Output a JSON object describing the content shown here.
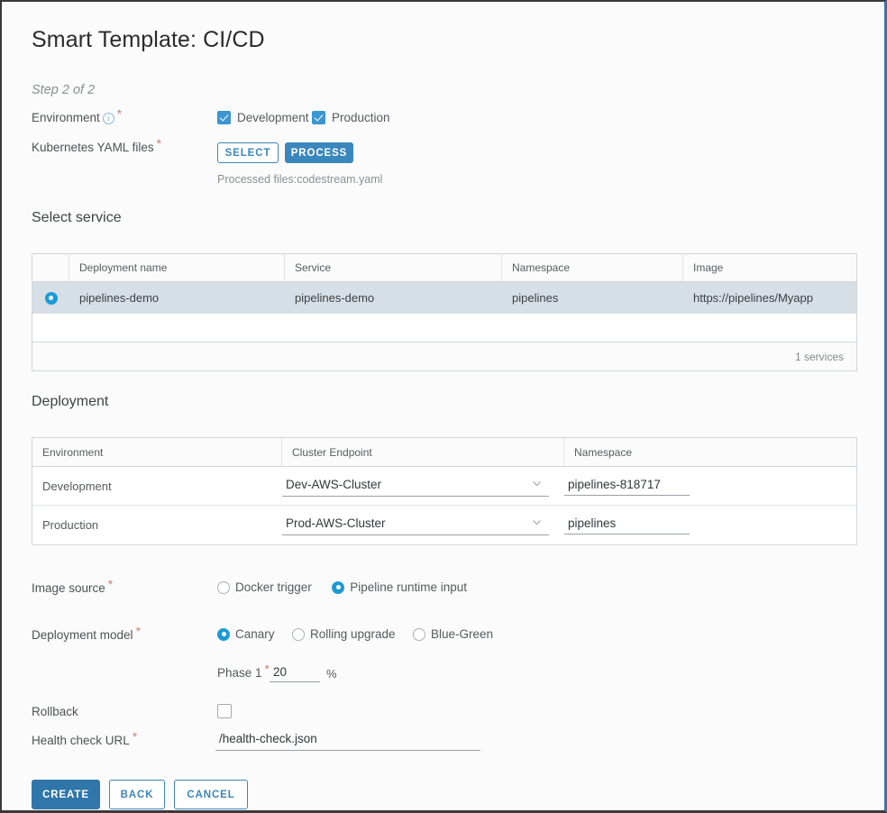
{
  "window": {
    "title": "Smart Template: CI/CD",
    "step_label": "Step 2 of 2",
    "accent_color": "#3076a8",
    "link_color": "#3b86b8",
    "required_mark_color": "#c8847a",
    "selected_row_color": "#d6dfe5"
  },
  "form": {
    "environment": {
      "label": "Environment",
      "info_icon": "info-circle-icon",
      "required_mark": "*",
      "options": [
        {
          "label": "Development",
          "checked": true
        },
        {
          "label": "Production",
          "checked": true
        }
      ]
    },
    "yaml_files": {
      "label": "Kubernetes YAML files",
      "required_mark": "*",
      "select_button": "SELECT",
      "process_button": "PROCESS",
      "processed_note": "Processed files:codestream.yaml"
    },
    "image_source": {
      "label": "Image source",
      "required_mark": "*",
      "options": [
        {
          "label": "Docker trigger",
          "selected": false
        },
        {
          "label": "Pipeline runtime input",
          "selected": true
        }
      ]
    },
    "deployment_model": {
      "label": "Deployment model",
      "required_mark": "*",
      "options": [
        {
          "label": "Canary",
          "selected": true
        },
        {
          "label": "Rolling upgrade",
          "selected": false
        },
        {
          "label": "Blue-Green",
          "selected": false
        }
      ],
      "phase": {
        "label": "Phase 1",
        "required_mark": "*",
        "value": "20",
        "unit": "%"
      }
    },
    "rollback": {
      "label": "Rollback",
      "checked": false
    },
    "health_check": {
      "label": "Health check URL",
      "required_mark": "*",
      "value": "/health-check.json",
      "placeholder": ""
    }
  },
  "select_service": {
    "heading": "Select service",
    "columns": [
      "Deployment name",
      "Service",
      "Namespace",
      "Image"
    ],
    "rows": [
      {
        "selected": true,
        "deployment_name": "pipelines-demo",
        "service": "pipelines-demo",
        "namespace": "pipelines",
        "image": "https://pipelines/Myapp"
      }
    ],
    "footer_count": "1 services"
  },
  "deployment": {
    "heading": "Deployment",
    "columns": [
      "Environment",
      "Cluster Endpoint",
      "Namespace"
    ],
    "rows": [
      {
        "environment": "Development",
        "cluster_endpoint": "Dev-AWS-Cluster",
        "cluster_endpoint_options": [
          "Dev-AWS-Cluster"
        ],
        "namespace": "pipelines-818717"
      },
      {
        "environment": "Production",
        "cluster_endpoint": "Prod-AWS-Cluster",
        "cluster_endpoint_options": [
          "Prod-AWS-Cluster"
        ],
        "namespace": "pipelines"
      }
    ]
  },
  "actions": {
    "create": "CREATE",
    "back": "BACK",
    "cancel": "CANCEL"
  }
}
